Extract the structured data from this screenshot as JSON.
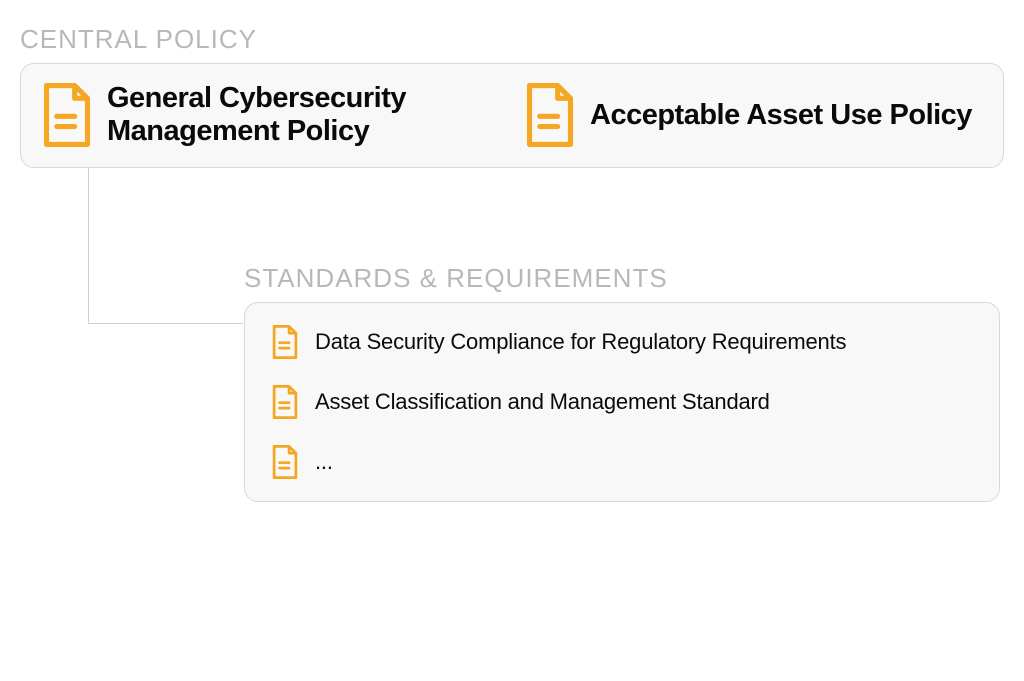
{
  "central_policy": {
    "label": "CENTRAL POLICY",
    "items": [
      {
        "title": "General Cybersecurity Management Policy"
      },
      {
        "title": "Acceptable Asset Use Policy"
      }
    ]
  },
  "standards": {
    "label": "STANDARDS & REQUIREMENTS",
    "items": [
      {
        "title": "Data Security Compliance for Regulatory Requirements"
      },
      {
        "title": "Asset Classification and Management Standard"
      },
      {
        "title": "..."
      }
    ]
  },
  "colors": {
    "icon": "#f5a623"
  }
}
